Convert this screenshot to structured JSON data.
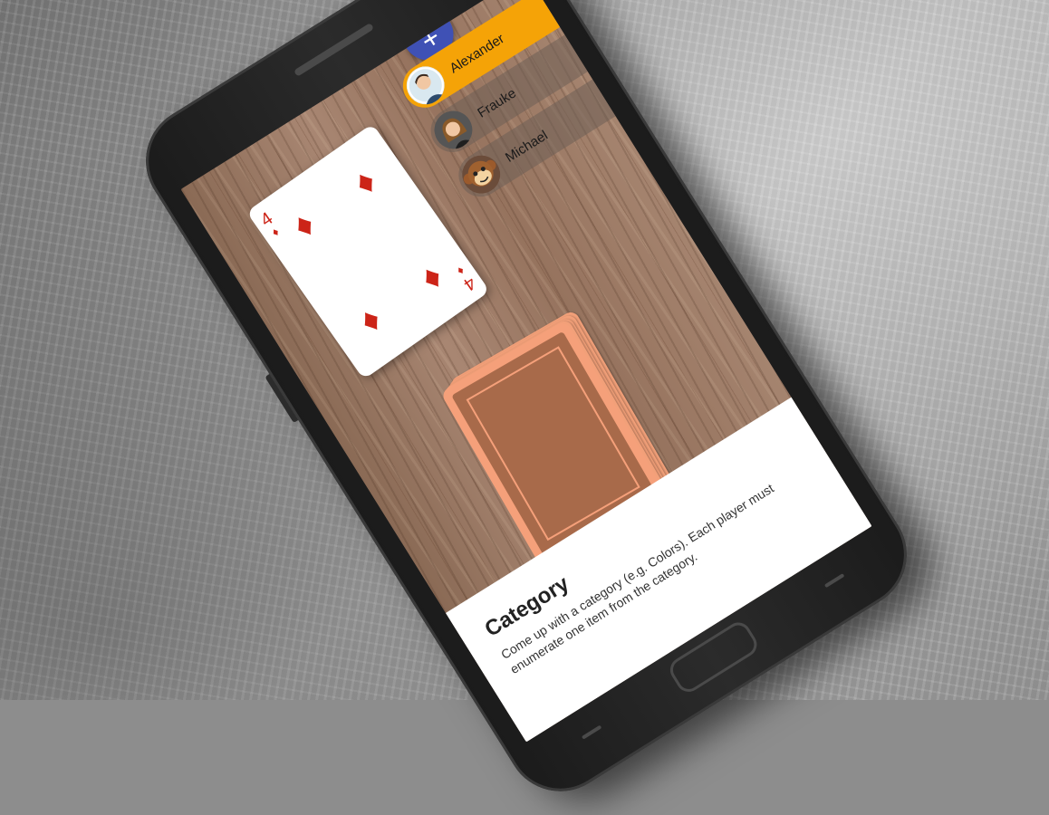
{
  "players": [
    {
      "name": "Alexander",
      "active": true,
      "avatar": "man-avatar-icon"
    },
    {
      "name": "Frauke",
      "active": false,
      "avatar": "woman-avatar-icon"
    },
    {
      "name": "Michael",
      "active": false,
      "avatar": "monkey-avatar-icon"
    }
  ],
  "fab": {
    "label": "+",
    "icon": "add-icon",
    "color": "#3f51b5"
  },
  "card": {
    "rank": "4",
    "suit": "♦",
    "suit_name": "diamonds",
    "color": "#cc2418"
  },
  "deck": {
    "color": "#f5a07a",
    "back_color": "#a86a4a"
  },
  "rule": {
    "title": "Category",
    "description": "Come up with a category (e.g. Colors). Each player must enumerate one item from the category."
  },
  "colors": {
    "active_player": "#f5a307"
  }
}
